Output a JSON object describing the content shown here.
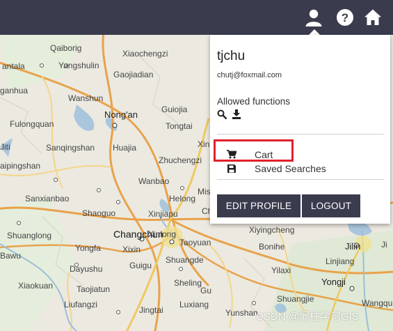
{
  "header": {
    "icons": [
      "user-icon",
      "help-icon",
      "home-icon"
    ]
  },
  "map": {
    "labels": [
      "Qaiborig",
      "Xiaochengzi",
      "Yangshulin",
      "Gaojiadian",
      "antala",
      "ganhua",
      "Wanshun",
      "Nong'an",
      "Guiojia",
      "Fulongquan",
      "Tongtai",
      "Jiti",
      "Sanqingshan",
      "Huajia",
      "Zhuchengzi",
      "aipingshan",
      "Wanbao",
      "Sanxianbao",
      "Helong",
      "Shaoguo",
      "Xinjiapu",
      "Changchun",
      "Shuanglong",
      "Xinlong",
      "Yongfa",
      "Xixin",
      "Taoyuan",
      "Bawu",
      "Shuangde",
      "Dayushu",
      "Guigu",
      "Xiaokuan",
      "Taojiatun",
      "Sheling",
      "Liufangzi",
      "Jingtai",
      "Luxiang",
      "Yunshan",
      "Xiyingcheng",
      "Bonihe",
      "Jilin",
      "Yilaxi",
      "Linjiang",
      "Yongji",
      "Shuangjie",
      "Wangqu",
      "Ji",
      "Xin",
      "Mis",
      "Ch",
      "Gu"
    ]
  },
  "profile": {
    "username": "tjchu",
    "email": "chutj@foxmail.com",
    "allowed_label": "Allowed functions",
    "func_icons": [
      "search-icon",
      "download-icon"
    ],
    "menu": [
      {
        "label": "Cart",
        "icon": "cart-icon",
        "highlighted": true
      },
      {
        "label": "Saved Searches",
        "icon": "saved-searches-icon",
        "highlighted": false
      }
    ],
    "edit_label": "EDIT PROFILE",
    "logout_label": "LOGOUT"
  },
  "watermark": "CSDN @阚柱学习GIS",
  "colors": {
    "header_bg": "#3a3c4e",
    "highlight_border": "#e0202a",
    "button_bg": "#3a3c4e"
  }
}
